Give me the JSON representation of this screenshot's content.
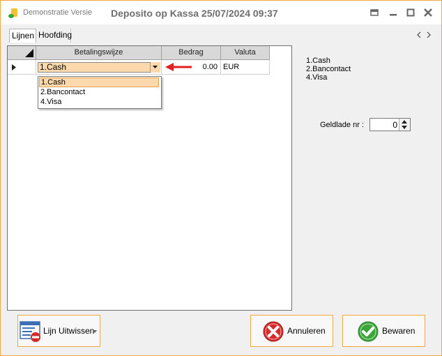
{
  "titlebar": {
    "brand": "Demonstratie Versie",
    "title": "Deposito op Kassa 25/07/2024 09:37"
  },
  "tabs": [
    {
      "label": "Lijnen",
      "active": true
    },
    {
      "label": "Hoofding",
      "active": false
    }
  ],
  "grid": {
    "headers": [
      "Betalingswijze",
      "Bedrag",
      "Valuta"
    ],
    "row": {
      "betalingswijze": "1.Cash",
      "bedrag": "0.00",
      "valuta": "EUR"
    }
  },
  "dropdown": {
    "options": [
      "1.Cash",
      "2.Bancontact",
      "4.Visa"
    ],
    "selected": "1.Cash"
  },
  "side_list": [
    "1.Cash",
    "2.Bancontact",
    "4.Visa"
  ],
  "geldlade": {
    "label": "Geldlade nr :",
    "value": "0"
  },
  "buttons": {
    "delete_line": "Lijn Uitwissen",
    "cancel": "Annuleren",
    "save": "Bewaren"
  },
  "colors": {
    "accent": "#f0a73c",
    "selection": "#fbd9ac",
    "cancel_red": "#d62b2b",
    "save_green": "#3aa63a",
    "arrow_red": "#e02020"
  }
}
